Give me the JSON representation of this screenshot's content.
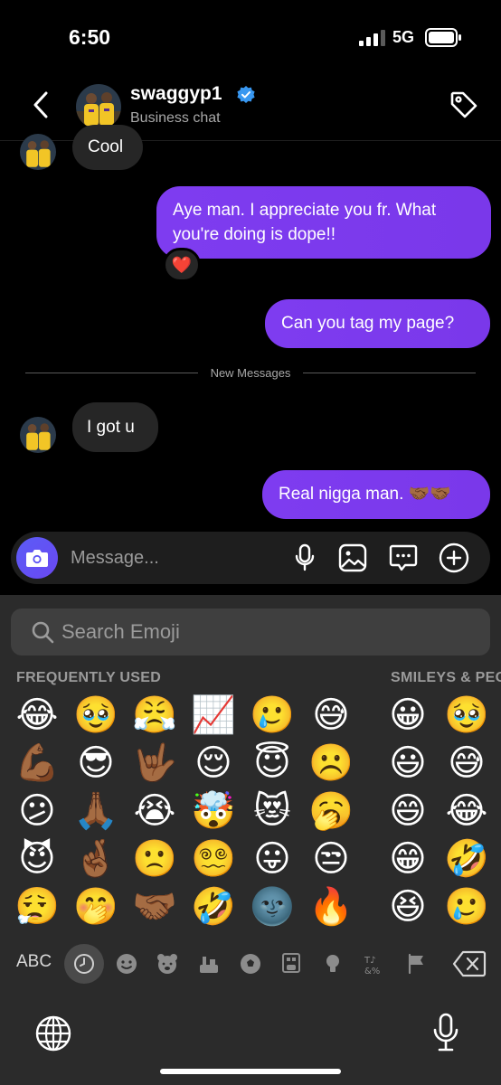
{
  "status_bar": {
    "time": "6:50",
    "network": "5G"
  },
  "header": {
    "username": "swaggyp1",
    "subtitle": "Business chat",
    "verified_color": "#3897f0"
  },
  "messages": [
    {
      "direction": "received",
      "text": "Cool"
    },
    {
      "direction": "sent",
      "text": "Aye man. I appreciate you fr. What you're doing is dope!!",
      "reaction": "❤️"
    },
    {
      "direction": "sent",
      "text": "Can you tag my page?"
    },
    {
      "divider": "New Messages"
    },
    {
      "direction": "received",
      "text": "I got u"
    },
    {
      "direction": "sent",
      "text": "Real nigga man. 🤝🏾🤝🏾"
    }
  ],
  "composer": {
    "placeholder": "Message..."
  },
  "keyboard": {
    "search_placeholder": "Search Emoji",
    "frequently_used_title": "FREQUENTLY USED",
    "smileys_title": "SMILEYS & PEOPLE",
    "abc_label": "ABC",
    "frequently_used": [
      [
        "😂",
        "🥹",
        "😤",
        "📈",
        "🥲",
        "😅"
      ],
      [
        "💪🏾",
        "😎",
        "🤟🏾",
        "😌",
        "😇",
        "☹️"
      ],
      [
        "😕",
        "🙏🏾",
        "😭",
        "🤯",
        "😻",
        "🥱"
      ],
      [
        "😈",
        "🤞🏾",
        "🙁",
        "😵‍💫",
        "😛",
        "😒"
      ],
      [
        "😮‍💨",
        "🤭",
        "🤝🏾",
        "🤣",
        "🌚",
        "🔥"
      ]
    ],
    "smileys": [
      [
        "😀",
        "🥹"
      ],
      [
        "😃",
        "😅"
      ],
      [
        "😄",
        "😂"
      ],
      [
        "😁",
        "🤣"
      ],
      [
        "😆",
        "🥲"
      ]
    ],
    "categories": [
      "recent-clock",
      "smiley",
      "bear",
      "food",
      "ball",
      "car",
      "bulb",
      "symbols",
      "flag"
    ],
    "accent_color": "#7b3aef"
  }
}
